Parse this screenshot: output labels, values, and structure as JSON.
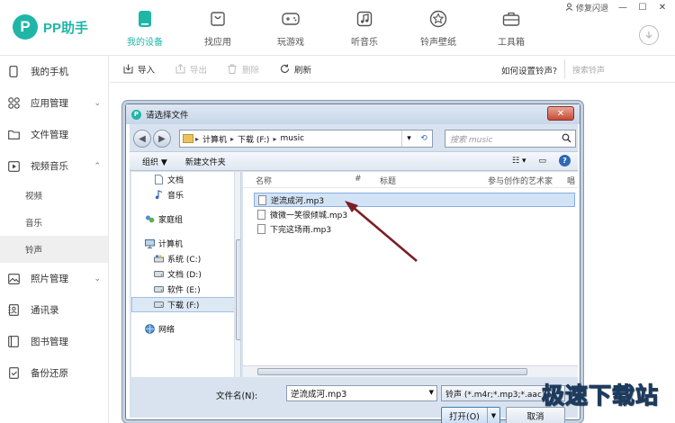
{
  "app": {
    "logo_text": "PP助手",
    "logo_mark": "P"
  },
  "window_controls": {
    "repair_label": "修复闪退"
  },
  "nav": [
    {
      "label": "我的设备",
      "icon": "phone-icon",
      "active": true
    },
    {
      "label": "找应用",
      "icon": "bag-icon",
      "active": false
    },
    {
      "label": "玩游戏",
      "icon": "gamepad-icon",
      "active": false
    },
    {
      "label": "听音乐",
      "icon": "music-note-icon",
      "active": false
    },
    {
      "label": "铃声壁纸",
      "icon": "star-icon",
      "active": false
    },
    {
      "label": "工具箱",
      "icon": "toolbox-icon",
      "active": false
    }
  ],
  "sidebar": {
    "items": [
      {
        "label": "我的手机",
        "icon": "phone-icon"
      },
      {
        "label": "应用管理",
        "icon": "apps-icon"
      },
      {
        "label": "文件管理",
        "icon": "folder-icon"
      },
      {
        "label": "视频音乐",
        "icon": "video-icon"
      },
      {
        "label": "照片管理",
        "icon": "photo-icon"
      },
      {
        "label": "通讯录",
        "icon": "contacts-icon"
      },
      {
        "label": "图书管理",
        "icon": "book-icon"
      },
      {
        "label": "备份还原",
        "icon": "backup-icon"
      }
    ],
    "subitems": [
      "视频",
      "音乐",
      "铃声"
    ],
    "active_sub": "铃声"
  },
  "toolbar": {
    "import": "导入",
    "export": "导出",
    "delete": "删除",
    "refresh": "刷新",
    "howto": "如何设置铃声?",
    "search_placeholder": "搜索铃声"
  },
  "dialog": {
    "title": "请选择文件",
    "close": "✕",
    "path": [
      "计算机",
      "下载 (F:)",
      "music"
    ],
    "search_placeholder": "搜索 music",
    "organize": "组织 ▼",
    "new_folder": "新建文件夹",
    "tree": {
      "libraries": [
        "文档",
        "音乐"
      ],
      "homegroup": "家庭组",
      "computer": "计算机",
      "drives": [
        "系统 (C:)",
        "文档 (D:)",
        "软件 (E:)",
        "下载 (F:)"
      ],
      "network": "网络",
      "selected": "下载 (F:)"
    },
    "columns": [
      "名称",
      "#",
      "标题",
      "参与创作的艺术家",
      "唱"
    ],
    "files": [
      "逆流成河.mp3",
      "微微一笑很倾城.mp3",
      "下完这场雨.mp3"
    ],
    "selected_file": "逆流成河.mp3",
    "filename_label": "文件名(N):",
    "filename_value": "逆流成河.mp3",
    "filter": "铃声 (*.m4r;*.mp3;*.aac)",
    "open": "打开(O)",
    "cancel": "取消"
  },
  "watermark": "极速下载站"
}
